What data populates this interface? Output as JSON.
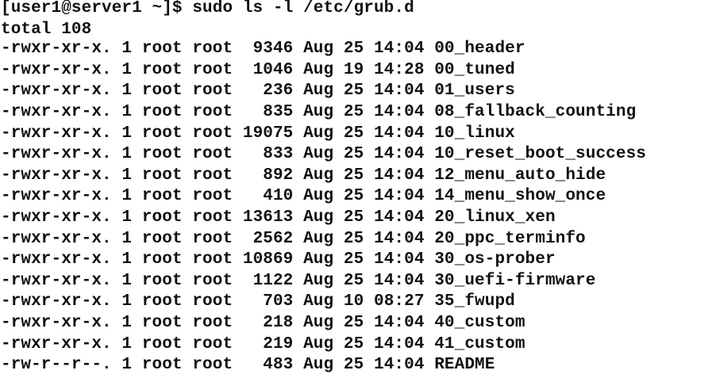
{
  "prompt": {
    "text": "[user1@server1 ~]$ sudo ls -l /etc/grub.d"
  },
  "total_line": "total 108",
  "entries": [
    {
      "perms": "-rwxr-xr-x.",
      "links": "1",
      "owner": "root",
      "group": "root",
      "size": "9346",
      "month": "Aug",
      "day": "25",
      "time": "14:04",
      "name": "00_header"
    },
    {
      "perms": "-rwxr-xr-x.",
      "links": "1",
      "owner": "root",
      "group": "root",
      "size": "1046",
      "month": "Aug",
      "day": "19",
      "time": "14:28",
      "name": "00_tuned"
    },
    {
      "perms": "-rwxr-xr-x.",
      "links": "1",
      "owner": "root",
      "group": "root",
      "size": "236",
      "month": "Aug",
      "day": "25",
      "time": "14:04",
      "name": "01_users"
    },
    {
      "perms": "-rwxr-xr-x.",
      "links": "1",
      "owner": "root",
      "group": "root",
      "size": "835",
      "month": "Aug",
      "day": "25",
      "time": "14:04",
      "name": "08_fallback_counting"
    },
    {
      "perms": "-rwxr-xr-x.",
      "links": "1",
      "owner": "root",
      "group": "root",
      "size": "19075",
      "month": "Aug",
      "day": "25",
      "time": "14:04",
      "name": "10_linux"
    },
    {
      "perms": "-rwxr-xr-x.",
      "links": "1",
      "owner": "root",
      "group": "root",
      "size": "833",
      "month": "Aug",
      "day": "25",
      "time": "14:04",
      "name": "10_reset_boot_success"
    },
    {
      "perms": "-rwxr-xr-x.",
      "links": "1",
      "owner": "root",
      "group": "root",
      "size": "892",
      "month": "Aug",
      "day": "25",
      "time": "14:04",
      "name": "12_menu_auto_hide"
    },
    {
      "perms": "-rwxr-xr-x.",
      "links": "1",
      "owner": "root",
      "group": "root",
      "size": "410",
      "month": "Aug",
      "day": "25",
      "time": "14:04",
      "name": "14_menu_show_once"
    },
    {
      "perms": "-rwxr-xr-x.",
      "links": "1",
      "owner": "root",
      "group": "root",
      "size": "13613",
      "month": "Aug",
      "day": "25",
      "time": "14:04",
      "name": "20_linux_xen"
    },
    {
      "perms": "-rwxr-xr-x.",
      "links": "1",
      "owner": "root",
      "group": "root",
      "size": "2562",
      "month": "Aug",
      "day": "25",
      "time": "14:04",
      "name": "20_ppc_terminfo"
    },
    {
      "perms": "-rwxr-xr-x.",
      "links": "1",
      "owner": "root",
      "group": "root",
      "size": "10869",
      "month": "Aug",
      "day": "25",
      "time": "14:04",
      "name": "30_os-prober"
    },
    {
      "perms": "-rwxr-xr-x.",
      "links": "1",
      "owner": "root",
      "group": "root",
      "size": "1122",
      "month": "Aug",
      "day": "25",
      "time": "14:04",
      "name": "30_uefi-firmware"
    },
    {
      "perms": "-rwxr-xr-x.",
      "links": "1",
      "owner": "root",
      "group": "root",
      "size": "703",
      "month": "Aug",
      "day": "10",
      "time": "08:27",
      "name": "35_fwupd"
    },
    {
      "perms": "-rwxr-xr-x.",
      "links": "1",
      "owner": "root",
      "group": "root",
      "size": "218",
      "month": "Aug",
      "day": "25",
      "time": "14:04",
      "name": "40_custom"
    },
    {
      "perms": "-rwxr-xr-x.",
      "links": "1",
      "owner": "root",
      "group": "root",
      "size": "219",
      "month": "Aug",
      "day": "25",
      "time": "14:04",
      "name": "41_custom"
    },
    {
      "perms": "-rw-r--r--.",
      "links": "1",
      "owner": "root",
      "group": "root",
      "size": "483",
      "month": "Aug",
      "day": "25",
      "time": "14:04",
      "name": "README"
    }
  ]
}
